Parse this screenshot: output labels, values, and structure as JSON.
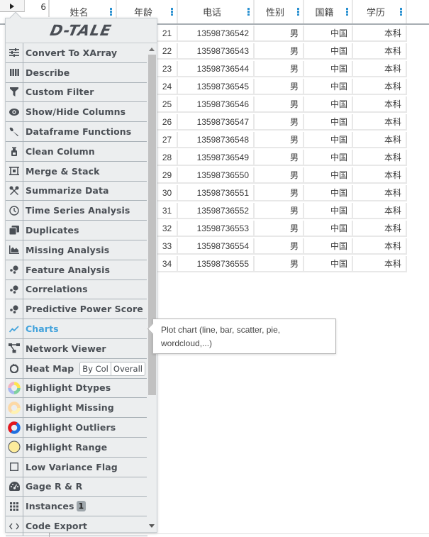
{
  "grid": {
    "row_count_label": "6",
    "columns": [
      {
        "key": "name",
        "label": "姓名"
      },
      {
        "key": "age",
        "label": "年龄"
      },
      {
        "key": "phone",
        "label": "电话"
      },
      {
        "key": "gender",
        "label": "性别"
      },
      {
        "key": "nationality",
        "label": "国籍"
      },
      {
        "key": "education",
        "label": "学历"
      }
    ],
    "rows": [
      {
        "age": "21",
        "phone": "13598736542",
        "gender": "男",
        "nationality": "中国",
        "education": "本科"
      },
      {
        "age": "22",
        "phone": "13598736543",
        "gender": "男",
        "nationality": "中国",
        "education": "本科"
      },
      {
        "age": "23",
        "phone": "13598736544",
        "gender": "男",
        "nationality": "中国",
        "education": "本科"
      },
      {
        "age": "24",
        "phone": "13598736545",
        "gender": "男",
        "nationality": "中国",
        "education": "本科"
      },
      {
        "age": "25",
        "phone": "13598736546",
        "gender": "男",
        "nationality": "中国",
        "education": "本科"
      },
      {
        "age": "26",
        "phone": "13598736547",
        "gender": "男",
        "nationality": "中国",
        "education": "本科"
      },
      {
        "age": "27",
        "phone": "13598736548",
        "gender": "男",
        "nationality": "中国",
        "education": "本科"
      },
      {
        "age": "28",
        "phone": "13598736549",
        "gender": "男",
        "nationality": "中国",
        "education": "本科"
      },
      {
        "age": "29",
        "phone": "13598736550",
        "gender": "男",
        "nationality": "中国",
        "education": "本科"
      },
      {
        "age": "30",
        "phone": "13598736551",
        "gender": "男",
        "nationality": "中国",
        "education": "本科"
      },
      {
        "age": "31",
        "phone": "13598736552",
        "gender": "男",
        "nationality": "中国",
        "education": "本科"
      },
      {
        "age": "32",
        "phone": "13598736553",
        "gender": "男",
        "nationality": "中国",
        "education": "本科"
      },
      {
        "age": "33",
        "phone": "13598736554",
        "gender": "男",
        "nationality": "中国",
        "education": "本科"
      },
      {
        "age": "34",
        "phone": "13598736555",
        "gender": "男",
        "nationality": "中国",
        "education": "本科"
      }
    ]
  },
  "menu": {
    "logo_text": "D-TALE",
    "items": [
      {
        "icon": "sliders-icon",
        "label": "Convert To XArray"
      },
      {
        "icon": "columns-icon",
        "label": "Describe"
      },
      {
        "icon": "filter-icon",
        "label": "Custom Filter"
      },
      {
        "icon": "eye-icon",
        "label": "Show/Hide Columns"
      },
      {
        "icon": "wrench-icon",
        "label": "Dataframe Functions"
      },
      {
        "icon": "spray-bottle-icon",
        "label": "Clean Column"
      },
      {
        "icon": "merge-icon",
        "label": "Merge & Stack"
      },
      {
        "icon": "tools-icon",
        "label": "Summarize Data"
      },
      {
        "icon": "clock-icon",
        "label": "Time Series Analysis"
      },
      {
        "icon": "copy-icon",
        "label": "Duplicates"
      },
      {
        "icon": "area-chart-icon",
        "label": "Missing Analysis"
      },
      {
        "icon": "scatter-dots-icon",
        "label": "Feature Analysis"
      },
      {
        "icon": "scatter-dots-icon",
        "label": "Correlations"
      },
      {
        "icon": "scatter-dots-icon",
        "label": "Predictive Power Score"
      },
      {
        "icon": "line-chart-icon",
        "label": "Charts",
        "active": true
      },
      {
        "icon": "network-icon",
        "label": "Network Viewer"
      },
      {
        "icon": "fire-icon",
        "label": "Heat Map",
        "buttons": [
          "By Col",
          "Overall"
        ]
      },
      {
        "icon": "dtypes-ring-icon",
        "label": "Highlight Dtypes"
      },
      {
        "icon": "missing-ring-icon",
        "label": "Highlight Missing"
      },
      {
        "icon": "outliers-ring-icon",
        "label": "Highlight Outliers"
      },
      {
        "icon": "range-circle-icon",
        "label": "Highlight Range"
      },
      {
        "icon": "checkbox-icon",
        "label": "Low Variance Flag"
      },
      {
        "icon": "gauge-icon",
        "label": "Gage R & R"
      },
      {
        "icon": "grid-dots-icon",
        "label": "Instances",
        "badge": "1"
      },
      {
        "icon": "code-icon",
        "label": "Code Export"
      }
    ]
  },
  "tooltip": {
    "text": "Plot chart (line, bar, scatter, pie, wordcloud,...)"
  },
  "colors": {
    "active_item": "#43a3dc",
    "header_dots": "#2a91d1",
    "menu_bg": "#eceeef"
  }
}
